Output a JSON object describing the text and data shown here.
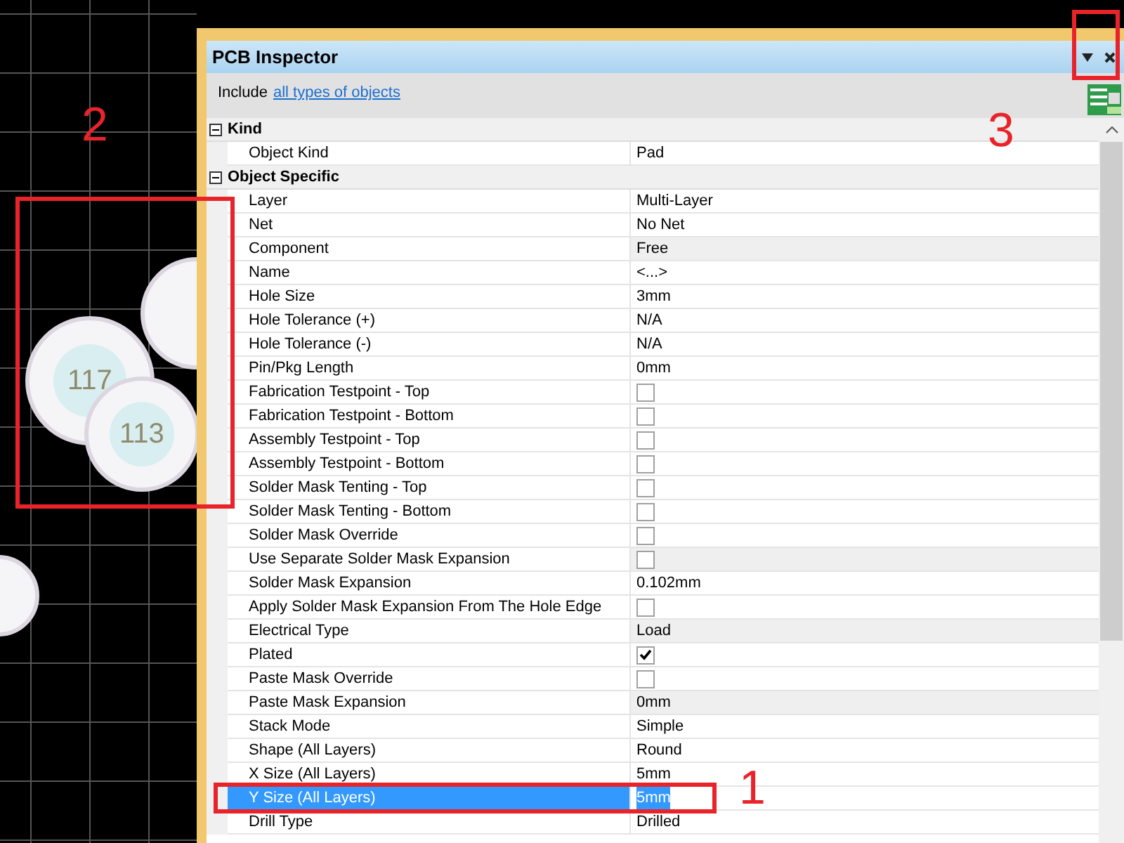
{
  "canvas": {
    "pads": [
      {
        "label": "117"
      },
      {
        "label": "113"
      }
    ]
  },
  "panel": {
    "title": "PCB Inspector",
    "include_label": "Include",
    "include_link": "all types of objects",
    "groups": [
      {
        "title": "Kind",
        "expanded": true,
        "rows": [
          {
            "kind": "text",
            "name": "Object Kind",
            "value": "Pad",
            "shaded": false,
            "selected": false
          }
        ]
      },
      {
        "title": "Object Specific",
        "expanded": true,
        "rows": [
          {
            "kind": "text",
            "name": "Layer",
            "value": "Multi-Layer",
            "shaded": false,
            "selected": false
          },
          {
            "kind": "text",
            "name": "Net",
            "value": "No Net",
            "shaded": false,
            "selected": false
          },
          {
            "kind": "text",
            "name": "Component",
            "value": "Free",
            "shaded": true,
            "selected": false
          },
          {
            "kind": "text",
            "name": "Name",
            "value": "<...>",
            "shaded": false,
            "selected": false
          },
          {
            "kind": "text",
            "name": "Hole Size",
            "value": "3mm",
            "shaded": false,
            "selected": false
          },
          {
            "kind": "text",
            "name": "Hole Tolerance (+)",
            "value": "N/A",
            "shaded": false,
            "selected": false
          },
          {
            "kind": "text",
            "name": "Hole Tolerance (-)",
            "value": "N/A",
            "shaded": false,
            "selected": false
          },
          {
            "kind": "text",
            "name": "Pin/Pkg Length",
            "value": "0mm",
            "shaded": false,
            "selected": false
          },
          {
            "kind": "checkbox",
            "name": "Fabrication Testpoint - Top",
            "checked": false,
            "shaded": false,
            "selected": false
          },
          {
            "kind": "checkbox",
            "name": "Fabrication Testpoint - Bottom",
            "checked": false,
            "shaded": false,
            "selected": false
          },
          {
            "kind": "checkbox",
            "name": "Assembly Testpoint - Top",
            "checked": false,
            "shaded": false,
            "selected": false
          },
          {
            "kind": "checkbox",
            "name": "Assembly Testpoint - Bottom",
            "checked": false,
            "shaded": false,
            "selected": false
          },
          {
            "kind": "checkbox",
            "name": "Solder Mask Tenting - Top",
            "checked": false,
            "shaded": false,
            "selected": false
          },
          {
            "kind": "checkbox",
            "name": "Solder Mask Tenting - Bottom",
            "checked": false,
            "shaded": false,
            "selected": false
          },
          {
            "kind": "checkbox",
            "name": "Solder Mask Override",
            "checked": false,
            "shaded": false,
            "selected": false
          },
          {
            "kind": "checkbox",
            "name": "Use Separate Solder Mask Expansion",
            "checked": false,
            "shaded": true,
            "selected": false
          },
          {
            "kind": "text",
            "name": "Solder Mask Expansion",
            "value": "0.102mm",
            "shaded": false,
            "selected": false
          },
          {
            "kind": "checkbox",
            "name": "Apply Solder Mask Expansion From The Hole Edge",
            "checked": false,
            "shaded": false,
            "selected": false
          },
          {
            "kind": "text",
            "name": "Electrical Type",
            "value": "Load",
            "shaded": true,
            "selected": false
          },
          {
            "kind": "checkbox",
            "name": "Plated",
            "checked": true,
            "shaded": false,
            "selected": false
          },
          {
            "kind": "checkbox",
            "name": "Paste Mask Override",
            "checked": false,
            "shaded": false,
            "selected": false
          },
          {
            "kind": "text",
            "name": "Paste Mask Expansion",
            "value": "0mm",
            "shaded": true,
            "selected": false
          },
          {
            "kind": "text",
            "name": "Stack Mode",
            "value": "Simple",
            "shaded": false,
            "selected": false
          },
          {
            "kind": "text",
            "name": "Shape (All Layers)",
            "value": "Round",
            "shaded": false,
            "selected": false
          },
          {
            "kind": "text",
            "name": "X Size (All Layers)",
            "value": "5mm",
            "shaded": false,
            "selected": false
          },
          {
            "kind": "text",
            "name": "Y Size (All Layers)",
            "value": "5mm",
            "shaded": false,
            "selected": true
          },
          {
            "kind": "text",
            "name": "Drill Type",
            "value": "Drilled",
            "shaded": false,
            "selected": false
          }
        ]
      }
    ]
  },
  "annotations": [
    {
      "label": "2"
    },
    {
      "label": "3"
    },
    {
      "label": "1"
    }
  ]
}
